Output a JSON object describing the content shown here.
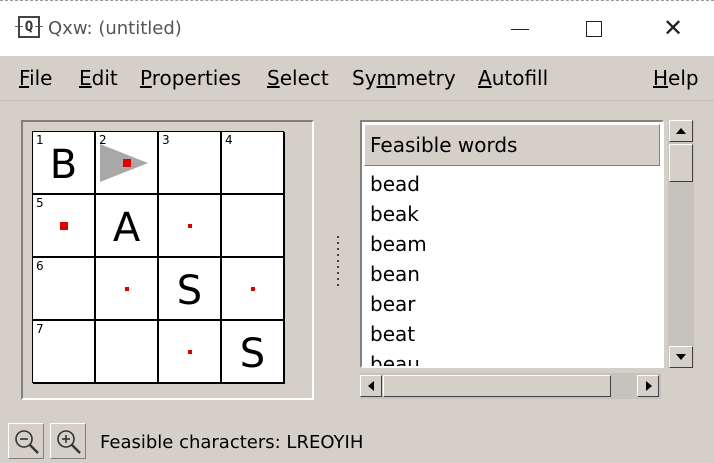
{
  "window": {
    "title": "Qxw: (untitled)",
    "app_icon_letter": "Q",
    "controls": [
      "minimize-icon",
      "maximize-icon",
      "close-icon"
    ],
    "close_glyph": "✕"
  },
  "menubar": [
    {
      "label": "File",
      "mnemonic": "F"
    },
    {
      "label": "Edit",
      "mnemonic": "E"
    },
    {
      "label": "Properties",
      "mnemonic": "P"
    },
    {
      "label": "Select",
      "mnemonic": "S"
    },
    {
      "label": "Symmetry",
      "mnemonic": "m"
    },
    {
      "label": "Autofill",
      "mnemonic": "A"
    },
    {
      "label": "Help",
      "mnemonic": "H"
    }
  ],
  "grid": {
    "rows": [
      [
        {
          "number": "1",
          "letter": "B",
          "dot": "none",
          "cursor": false
        },
        {
          "number": "2",
          "letter": "",
          "dot": "large",
          "cursor": true
        },
        {
          "number": "3",
          "letter": "",
          "dot": "none",
          "cursor": false
        },
        {
          "number": "4",
          "letter": "",
          "dot": "none",
          "cursor": false
        }
      ],
      [
        {
          "number": "5",
          "letter": "",
          "dot": "large",
          "cursor": false
        },
        {
          "number": "",
          "letter": "A",
          "dot": "none",
          "cursor": false
        },
        {
          "number": "",
          "letter": "",
          "dot": "small",
          "cursor": false
        },
        {
          "number": "",
          "letter": "",
          "dot": "none",
          "cursor": false
        }
      ],
      [
        {
          "number": "6",
          "letter": "",
          "dot": "none",
          "cursor": false
        },
        {
          "number": "",
          "letter": "",
          "dot": "small",
          "cursor": false
        },
        {
          "number": "",
          "letter": "S",
          "dot": "none",
          "cursor": false
        },
        {
          "number": "",
          "letter": "",
          "dot": "small",
          "cursor": false
        }
      ],
      [
        {
          "number": "7",
          "letter": "",
          "dot": "none",
          "cursor": false
        },
        {
          "number": "",
          "letter": "",
          "dot": "none",
          "cursor": false
        },
        {
          "number": "",
          "letter": "",
          "dot": "small",
          "cursor": false
        },
        {
          "number": "",
          "letter": "S",
          "dot": "none",
          "cursor": false
        }
      ]
    ],
    "dot_color": "#e00000",
    "cursor_color": "#a8a8a8"
  },
  "feasible_words": {
    "header": "Feasible words",
    "items": [
      "bead",
      "beak",
      "beam",
      "bean",
      "bear",
      "beat",
      "beau"
    ]
  },
  "status": {
    "zoom_out_icon": "zoom-out-icon",
    "zoom_in_icon": "zoom-in-icon",
    "text": "Feasible characters: LREOYIH"
  }
}
